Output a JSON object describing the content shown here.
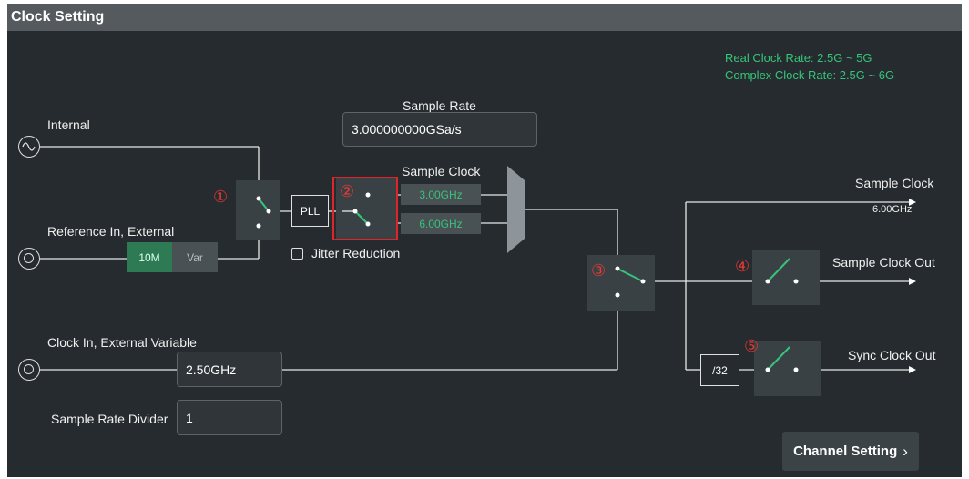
{
  "window": {
    "title": "Clock Setting"
  },
  "info": {
    "real_rate": "Real Clock Rate: 2.5G ~ 5G",
    "complex_rate": "Complex Clock Rate: 2.5G ~ 6G"
  },
  "sample_rate": {
    "label": "Sample Rate",
    "value": "3.000000000GSa/s"
  },
  "sources": {
    "internal": "Internal",
    "ref_in": "Reference In, External",
    "clock_in": "Clock In, External Variable"
  },
  "ref_toggle": {
    "opt1": "10M",
    "opt2": "Var",
    "selected": "10M"
  },
  "pll": {
    "label": "PLL"
  },
  "sample_clock_sel": {
    "label": "Sample Clock",
    "opt1": "3.00GHz",
    "opt2": "6.00GHz",
    "selected": "6.00GHz"
  },
  "jitter": {
    "label": "Jitter Reduction",
    "checked": false
  },
  "clock_in": {
    "value": "2.50GHz"
  },
  "divider": {
    "label": "Sample Rate Divider",
    "value": "1"
  },
  "outputs": {
    "sample_clock": "Sample Clock",
    "sample_clock_value": "6.00GHz",
    "sample_clock_out": "Sample Clock Out",
    "sync_clock_out": "Sync Clock Out",
    "div32": "/32"
  },
  "badges": [
    "①",
    "②",
    "③",
    "④",
    "⑤"
  ],
  "nav": {
    "channel_setting": "Channel Setting",
    "chevron": "›"
  },
  "colors": {
    "accent": "#37c47a",
    "background": "#252b2e",
    "highlight": "#e53935"
  }
}
